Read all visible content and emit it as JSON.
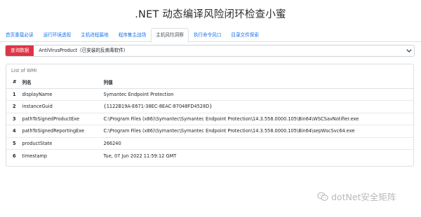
{
  "header": {
    "title": ".NET 动态编译风险闭环检查小蜜"
  },
  "tabs": [
    {
      "label": "首页重载必读"
    },
    {
      "label": "运行环境透视"
    },
    {
      "label": "主机进程篇地"
    },
    {
      "label": "程序集主战场"
    },
    {
      "label": "主机风险洞察"
    },
    {
      "label": "执行命令风口"
    },
    {
      "label": "目录文件探索"
    }
  ],
  "query": {
    "button_label": "查询数据",
    "selected_value": "AntiVirusProduct（已安装的反病毒软件）"
  },
  "wmi_card": {
    "title": "List of WMI",
    "columns": {
      "index": "#",
      "name": "列名",
      "value": "列值"
    },
    "rows": [
      {
        "index": "1",
        "name": "displayName",
        "value": "Symantec Endpoint Protection"
      },
      {
        "index": "2",
        "name": "instanceGuid",
        "value": "{1122B19A-E671-38EC-8EAC-87048FD4528D}"
      },
      {
        "index": "3",
        "name": "pathToSignedProductExe",
        "value": "C:\\Program Files (x86)\\Symantec\\Symantec Endpoint Protection\\14.3.558.0000.105\\Bin64\\WSCSavNotifier.exe"
      },
      {
        "index": "4",
        "name": "pathToSignedReportingExe",
        "value": "C:\\Program Files (x86)\\Symantec\\Symantec Endpoint Protection\\14.3.558.0000.105\\Bin64\\sepWscSvc64.exe"
      },
      {
        "index": "5",
        "name": "productState",
        "value": "266240"
      },
      {
        "index": "6",
        "name": "timestamp",
        "value": "Tue, 07 Jun 2022 11:59:12 GMT"
      }
    ]
  },
  "watermark": {
    "text": "dotNet安全矩阵",
    "icon": "wechat-icon"
  }
}
